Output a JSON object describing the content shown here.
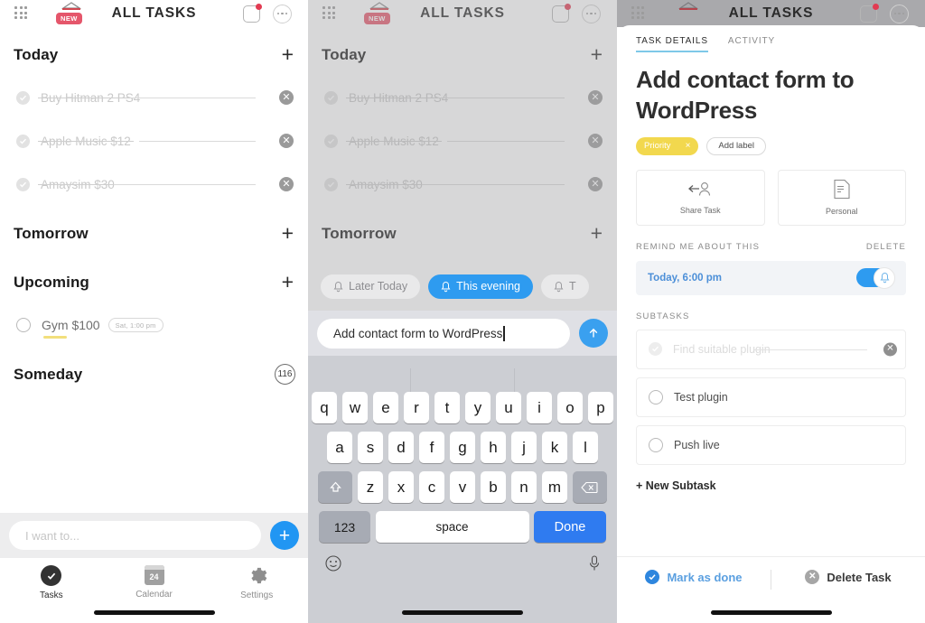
{
  "appbar": {
    "title": "ALL TASKS",
    "new_badge": "NEW",
    "grid_icon": "grid-dots-icon",
    "basket_icon": "basket-icon",
    "inbox_icon": "inbox-square-icon",
    "more_icon": "more-dots-icon"
  },
  "list": {
    "sections": [
      {
        "title": "Today",
        "action": "+"
      },
      {
        "title": "Tomorrow",
        "action": "+"
      },
      {
        "title": "Upcoming",
        "action": "+"
      },
      {
        "title": "Someday",
        "count": "116"
      }
    ],
    "today_tasks": [
      {
        "text": "Buy Hitman 2 PS4",
        "done": true
      },
      {
        "text": "Apple Music $12",
        "done": true
      },
      {
        "text": "Amaysim $30",
        "done": true
      }
    ],
    "upcoming_tasks": [
      {
        "text": "Gym $100",
        "badge": "Sat, 1:00 pm",
        "done": false
      }
    ]
  },
  "compose": {
    "placeholder": "I want to...",
    "fab_label": "+"
  },
  "tabbar": {
    "tabs": [
      {
        "label": "Tasks",
        "icon": "check-circle-icon",
        "active": true
      },
      {
        "label": "Calendar",
        "icon": "calendar-icon",
        "day": "24",
        "active": false
      },
      {
        "label": "Settings",
        "icon": "gear-icon",
        "active": false
      }
    ]
  },
  "panel2": {
    "chips": [
      {
        "label": "Later Today",
        "active": false
      },
      {
        "label": "This evening",
        "active": true
      },
      {
        "label": "T",
        "active": false
      }
    ],
    "input_value": "Add contact form to WordPress",
    "send_icon": "arrow-up-icon",
    "keyboard": {
      "row1": [
        "q",
        "w",
        "e",
        "r",
        "t",
        "y",
        "u",
        "i",
        "o",
        "p"
      ],
      "row2": [
        "a",
        "s",
        "d",
        "f",
        "g",
        "h",
        "j",
        "k",
        "l"
      ],
      "row3": [
        "z",
        "x",
        "c",
        "v",
        "b",
        "n",
        "m"
      ],
      "shift": "shift-icon",
      "backspace": "backspace-icon",
      "numbers": "123",
      "space": "space",
      "done": "Done",
      "emoji": "emoji-icon",
      "mic": "microphone-icon"
    }
  },
  "panel3": {
    "tabs": [
      {
        "label": "TASK DETAILS",
        "active": true
      },
      {
        "label": "ACTIVITY",
        "active": false
      }
    ],
    "title": "Add contact form to WordPress",
    "labels": {
      "priority": "Priority",
      "priority_remove": "×",
      "add_label": "Add label",
      "priority_color": "#f2d84e"
    },
    "cards": [
      {
        "label": "Share Task",
        "icon": "share-person-icon"
      },
      {
        "label": "Personal",
        "icon": "document-icon"
      }
    ],
    "reminder_section": {
      "heading": "REMIND ME ABOUT THIS",
      "delete": "DELETE",
      "value": "Today, 6:00 pm",
      "toggle_on": true,
      "toggle_color": "#2e9bf0",
      "bell_icon": "bell-icon"
    },
    "subtasks_section": {
      "heading": "SUBTASKS",
      "items": [
        {
          "text": "Find suitable plugin",
          "done": true
        },
        {
          "text": "Test plugin",
          "done": false
        },
        {
          "text": "Push live",
          "done": false
        }
      ],
      "new_subtask": "+ New Subtask"
    },
    "footer": {
      "mark_done": "Mark as done",
      "mark_done_icon": "check-circle-icon",
      "delete_task": "Delete Task",
      "delete_task_icon": "x-circle-icon"
    }
  }
}
